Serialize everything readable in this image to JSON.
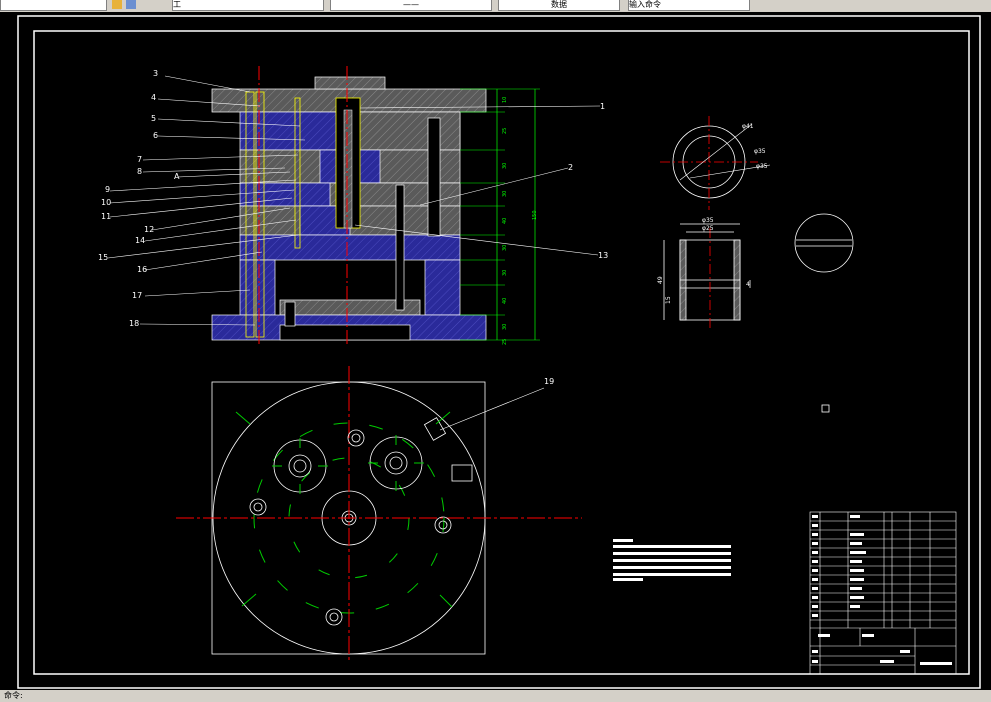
{
  "toolbar": {
    "segments": [
      {
        "text": ""
      },
      {
        "text": "工"
      },
      {
        "text": "——"
      },
      {
        "text": "数据"
      },
      {
        "text": "输入命令"
      }
    ]
  },
  "status": {
    "text": "命令:"
  },
  "drawing": {
    "part_labels": [
      "1",
      "2",
      "3",
      "4",
      "5",
      "6",
      "7",
      "8",
      "9",
      "10",
      "11",
      "12",
      "13",
      "14",
      "15",
      "16",
      "17",
      "18",
      "19",
      "A"
    ],
    "dims_vertical": [
      "10",
      "25",
      "30",
      "30",
      "40",
      "30",
      "30",
      "40",
      "30",
      "25",
      "150"
    ],
    "detail_dims": [
      "φ25",
      "φ35",
      "φ41",
      "φ35",
      "φ35",
      "4",
      "15",
      "49"
    ]
  },
  "colors": {
    "background": "#000000",
    "frame": "#ffffff",
    "hatch_blue": "#2a2a9a",
    "hatch_gray": "#6e6e6e",
    "center_red": "#ff0000",
    "dim_green": "#00ff00",
    "dash_green": "#00cc00",
    "yellow": "#ffff00"
  }
}
